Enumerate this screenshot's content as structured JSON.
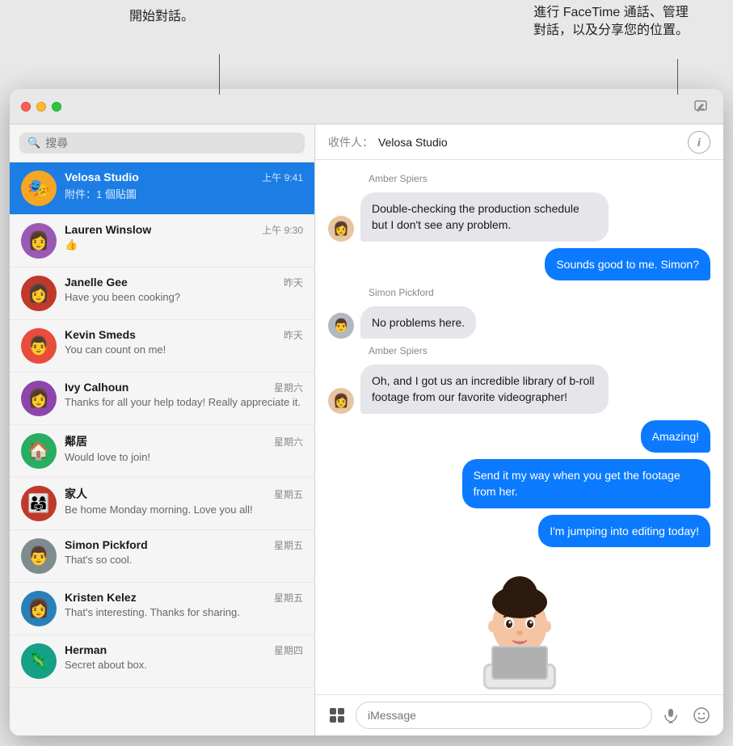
{
  "callouts": {
    "left_text": "開始對話。",
    "right_text": "進行 FaceTime 通話、管理\n對話，以及分享您的位置。"
  },
  "titlebar": {
    "compose_label": "✏"
  },
  "sidebar": {
    "search_placeholder": "搜尋",
    "conversations": [
      {
        "id": "velosa",
        "name": "Velosa Studio",
        "time": "上午 9:41",
        "preview": "附件：1 個貼圖",
        "emoji": "🎭",
        "active": true
      },
      {
        "id": "lauren",
        "name": "Lauren Winslow",
        "time": "上午 9:30",
        "preview": "👍",
        "emoji": "👩",
        "active": false
      },
      {
        "id": "janelle",
        "name": "Janelle Gee",
        "time": "昨天",
        "preview": "Have you been cooking?",
        "emoji": "👩",
        "active": false
      },
      {
        "id": "kevin",
        "name": "Kevin Smeds",
        "time": "昨天",
        "preview": "You can count on me!",
        "emoji": "👨",
        "active": false
      },
      {
        "id": "ivy",
        "name": "Ivy Calhoun",
        "time": "星期六",
        "preview": "Thanks for all your help today! Really appreciate it.",
        "emoji": "👩",
        "active": false
      },
      {
        "id": "neighbor",
        "name": "鄰居",
        "time": "星期六",
        "preview": "Would love to join!",
        "emoji": "🏠",
        "active": false
      },
      {
        "id": "family",
        "name": "家人",
        "time": "星期五",
        "preview": "Be home Monday morning. Love you all!",
        "emoji": "👨‍👩‍👧",
        "active": false
      },
      {
        "id": "simon",
        "name": "Simon Pickford",
        "time": "星期五",
        "preview": "That's so cool.",
        "emoji": "👨",
        "active": false
      },
      {
        "id": "kristen",
        "name": "Kristen Kelez",
        "time": "星期五",
        "preview": "That's interesting. Thanks for sharing.",
        "emoji": "👩",
        "active": false
      },
      {
        "id": "herman",
        "name": "Herman",
        "time": "星期四",
        "preview": "Secret about box.",
        "emoji": "🦎",
        "active": false
      }
    ]
  },
  "chat": {
    "recipient_label": "收件人：",
    "recipient_name": "Velosa Studio",
    "messages": [
      {
        "id": "m1",
        "sender": "Amber Spiers",
        "direction": "incoming",
        "text": "Double-checking the production schedule but I don't see any problem.",
        "show_avatar": true,
        "avatar_emoji": "👩"
      },
      {
        "id": "m2",
        "sender": "me",
        "direction": "outgoing",
        "text": "Sounds good to me. Simon?",
        "show_avatar": false,
        "avatar_emoji": ""
      },
      {
        "id": "m3",
        "sender": "Simon Pickford",
        "direction": "incoming",
        "text": "No problems here.",
        "show_avatar": true,
        "avatar_emoji": "👨"
      },
      {
        "id": "m4",
        "sender": "Amber Spiers",
        "direction": "incoming",
        "text": "Oh, and I got us an incredible library of b-roll footage from our favorite videographer!",
        "show_avatar": true,
        "avatar_emoji": "👩"
      },
      {
        "id": "m5",
        "sender": "me",
        "direction": "outgoing",
        "text": "Amazing!",
        "show_avatar": false,
        "avatar_emoji": ""
      },
      {
        "id": "m6",
        "sender": "me",
        "direction": "outgoing",
        "text": "Send it my way when you get the footage from her.",
        "show_avatar": false,
        "avatar_emoji": ""
      },
      {
        "id": "m7",
        "sender": "me",
        "direction": "outgoing",
        "text": "I'm jumping into editing today!",
        "show_avatar": false,
        "avatar_emoji": ""
      }
    ],
    "input_placeholder": "iMessage",
    "appstore_icon": "🅐",
    "emoji_icon": "🙂"
  }
}
